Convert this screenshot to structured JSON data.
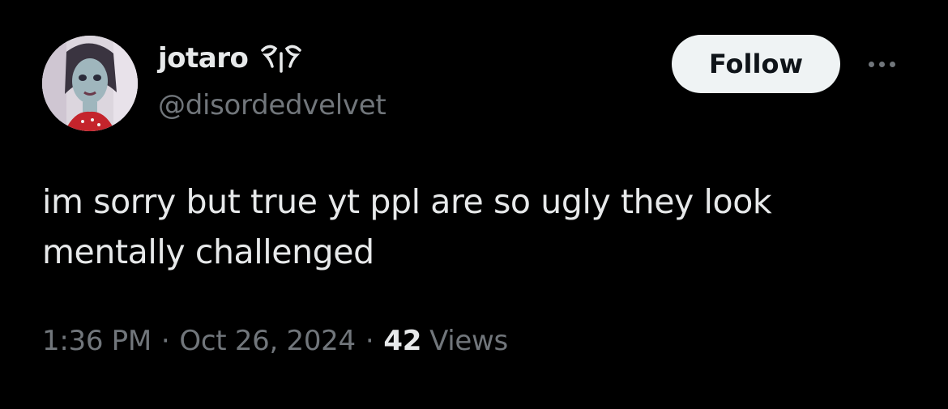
{
  "author": {
    "display_name": "jotaro",
    "handle": "@disordedvelvet",
    "avatar_icon": "profile-avatar",
    "name_glyph_icon": "winged-symbol-icon"
  },
  "actions": {
    "follow_label": "Follow",
    "more_icon": "more-options-icon"
  },
  "tweet": {
    "text": "im sorry but true yt ppl are so ugly they look mentally challenged"
  },
  "meta": {
    "time": "1:36 PM",
    "separator": "·",
    "date": "Oct 26, 2024",
    "views_count": "42",
    "views_label": "Views"
  },
  "colors": {
    "background": "#000000",
    "primary_text": "#e7e9ea",
    "secondary_text": "#71767b",
    "follow_bg": "#eff3f4",
    "follow_text": "#0f1419"
  }
}
